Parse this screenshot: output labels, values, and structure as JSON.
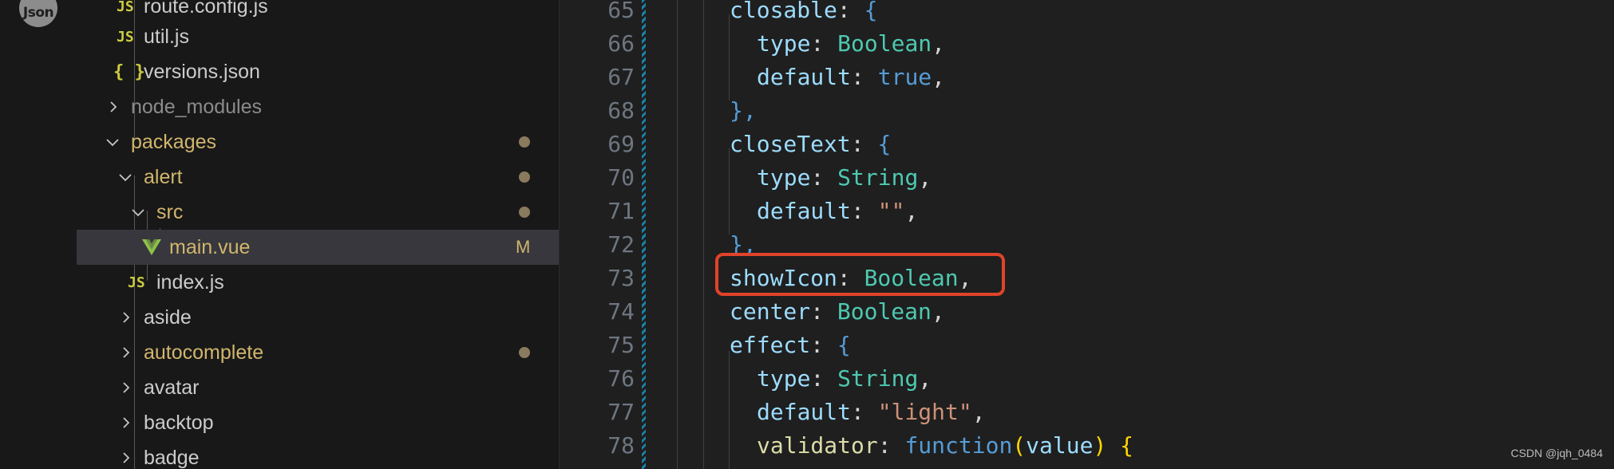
{
  "activity_bar": {
    "avatar_text": "Json"
  },
  "explorer": {
    "items": [
      {
        "label": "route.config.js",
        "icon": "js-file-icon",
        "icon_text": "JS"
      },
      {
        "label": "util.js",
        "icon": "js-file-icon",
        "icon_text": "JS"
      },
      {
        "label": "versions.json",
        "icon": "json-file-icon",
        "icon_text": "{ }"
      },
      {
        "label": "node_modules",
        "state": "collapsed"
      },
      {
        "label": "packages",
        "state": "expanded",
        "modified": true
      },
      {
        "label": "alert",
        "state": "expanded",
        "modified": true
      },
      {
        "label": "src",
        "state": "expanded",
        "modified": true
      },
      {
        "label": "main.vue",
        "icon": "vue-file-icon",
        "badge": "M",
        "selected": true
      },
      {
        "label": "index.js",
        "icon": "js-file-icon",
        "icon_text": "JS"
      },
      {
        "label": "aside",
        "state": "collapsed"
      },
      {
        "label": "autocomplete",
        "state": "collapsed",
        "modified": true
      },
      {
        "label": "avatar",
        "state": "collapsed"
      },
      {
        "label": "backtop",
        "state": "collapsed"
      },
      {
        "label": "badge",
        "state": "collapsed"
      }
    ]
  },
  "editor": {
    "line_numbers": [
      "65",
      "66",
      "67",
      "68",
      "69",
      "70",
      "71",
      "72",
      "73",
      "74",
      "75",
      "76",
      "77",
      "78"
    ],
    "code": {
      "l65": {
        "key": "closable",
        "colon": ":",
        "brace": "{"
      },
      "l66": {
        "key": "type",
        "colon": ":",
        "value": "Boolean",
        "comma": ","
      },
      "l67": {
        "key": "default",
        "colon": ":",
        "value": "true",
        "comma": ","
      },
      "l68": {
        "close": "},"
      },
      "l69": {
        "key": "closeText",
        "colon": ":",
        "brace": "{"
      },
      "l70": {
        "key": "type",
        "colon": ":",
        "value": "String",
        "comma": ","
      },
      "l71": {
        "key": "default",
        "colon": ":",
        "value": "\"\"",
        "comma": ","
      },
      "l72": {
        "close": "},"
      },
      "l73": {
        "key": "showIcon",
        "colon": ":",
        "value": "Boolean",
        "comma": ","
      },
      "l74": {
        "key": "center",
        "colon": ":",
        "value": "Boolean",
        "comma": ","
      },
      "l75": {
        "key": "effect",
        "colon": ":",
        "brace": "{"
      },
      "l76": {
        "key": "type",
        "colon": ":",
        "value": "String",
        "comma": ","
      },
      "l77": {
        "key": "default",
        "colon": ":",
        "value": "\"light\"",
        "comma": ","
      },
      "l78": {
        "key": "validator",
        "colon": ":",
        "fn_keyword": "function",
        "paren_open": "(",
        "param": "value",
        "paren_close": ")",
        "brace": "{"
      }
    },
    "highlight_color": "#e0432a"
  },
  "watermark": "CSDN @jqh_0484",
  "colors": {
    "key": "#9cdcfe",
    "type": "#4ec9b0",
    "keyword": "#569cd6",
    "string": "#ce9178",
    "modified": "#d1b66d"
  }
}
